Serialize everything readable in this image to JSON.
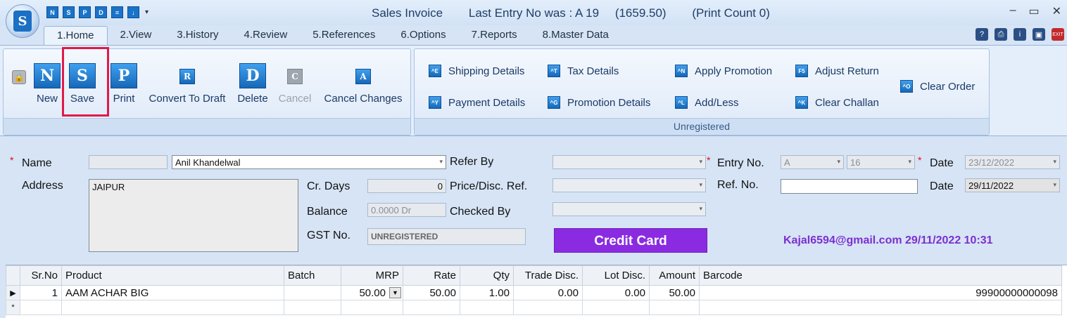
{
  "titlebar": {
    "app_icon_letter": "S",
    "quick_access": [
      "N",
      "S",
      "P",
      "D",
      "≡",
      "↓"
    ],
    "quick_access_dropdown": "▾",
    "title": "Sales Invoice",
    "last_entry": "Last Entry No was : A 19",
    "last_amount": "(1659.50)",
    "print_count": "(Print Count 0)",
    "minimize": "–",
    "maximize": "▭",
    "close": "✕"
  },
  "tabs": [
    "1.Home",
    "2.View",
    "3.History",
    "4.Review",
    "5.References",
    "6.Options",
    "7.Reports",
    "8.Master Data"
  ],
  "tab_icons": [
    "?",
    "⎙",
    "i",
    "▣",
    "EXIT"
  ],
  "ribbon": {
    "big_buttons": [
      {
        "label": "New",
        "icon": "N"
      },
      {
        "label": "Save",
        "icon": "S"
      },
      {
        "label": "Print",
        "icon": "P"
      },
      {
        "label": "Convert To Draft",
        "icon": "R"
      },
      {
        "label": "Delete",
        "icon": "D"
      },
      {
        "label": "Cancel",
        "icon": "C"
      },
      {
        "label": "Cancel Changes",
        "icon": "A"
      }
    ],
    "small_buttons": [
      {
        "label": "Shipping Details",
        "icon": "^E"
      },
      {
        "label": "Payment Details",
        "icon": "^Y"
      },
      {
        "label": "Tax Details",
        "icon": "^T"
      },
      {
        "label": "Promotion Details",
        "icon": "^G"
      },
      {
        "label": "Apply Promotion",
        "icon": "^N"
      },
      {
        "label": "Add/Less",
        "icon": "^L"
      },
      {
        "label": "Adjust Return",
        "icon": "F5"
      },
      {
        "label": "Clear Challan",
        "icon": "^K"
      },
      {
        "label": "Clear Order",
        "icon": "^O"
      }
    ],
    "group2_footer": "Unregistered"
  },
  "form": {
    "name_label": "Name",
    "name_code": "",
    "name_value": "Anil Khandelwal",
    "address_label": "Address",
    "address_value": "JAIPUR",
    "cr_days_label": "Cr. Days",
    "cr_days_value": "0",
    "balance_label": "Balance",
    "balance_value": "0.0000 Dr",
    "gst_label": "GST No.",
    "gst_value": "UNREGISTERED",
    "refer_by_label": "Refer By",
    "price_ref_label": "Price/Disc. Ref.",
    "checked_by_label": "Checked By",
    "entry_no_label": "Entry No.",
    "entry_series": "A",
    "entry_number": "16",
    "date_label": "Date",
    "date_value": "23/12/2022",
    "ref_no_label": "Ref. No.",
    "ref_date_label": "Date",
    "ref_date_value": "29/11/2022",
    "credit_card_label": "Credit Card",
    "user_stamp": "Kajal6594@gmail.com 29/11/2022 10:31"
  },
  "grid": {
    "columns": [
      "Sr.No",
      "Product",
      "Batch",
      "MRP",
      "Rate",
      "Qty",
      "Trade Disc.",
      "Lot Disc.",
      "Amount",
      "Barcode"
    ],
    "rows": [
      {
        "sr": "1",
        "product": "AAM ACHAR BIG",
        "batch": "",
        "mrp": "50.00",
        "rate": "50.00",
        "qty": "1.00",
        "trade_disc": "0.00",
        "lot_disc": "0.00",
        "amount": "50.00",
        "barcode": "99900000000098"
      }
    ],
    "current_row_marker": "▶",
    "new_row_marker": "*"
  }
}
